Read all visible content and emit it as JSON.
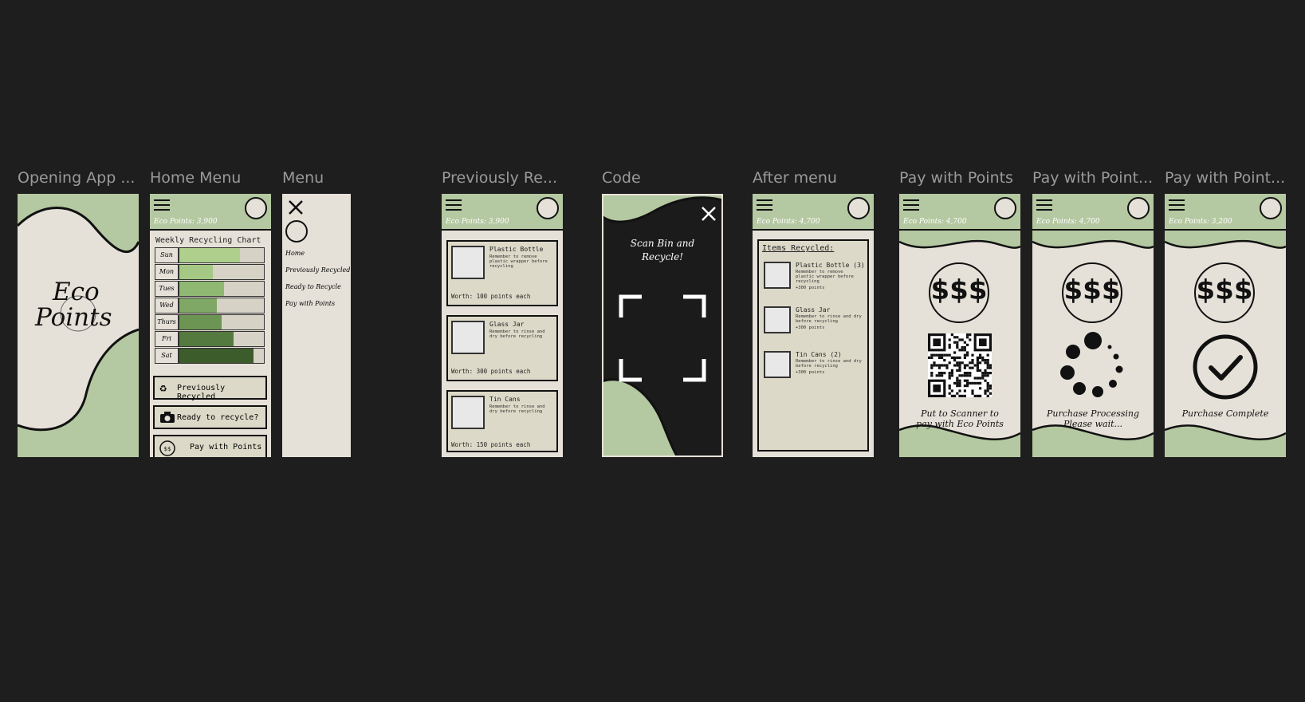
{
  "frames": {
    "opening": {
      "title": "Opening App ...",
      "logo_line1": "Eco",
      "logo_line2": "Points"
    },
    "home": {
      "title": "Home Menu",
      "points": "Eco Points: 3,900",
      "chart_title": "Weekly Recycling Chart",
      "buttons": {
        "previously": "Previously Recycled",
        "ready": "Ready to recycle?",
        "pay": "Pay with Points"
      }
    },
    "menu": {
      "title": "Menu",
      "items": {
        "home": "Home",
        "previously": "Previously Recycled",
        "ready": "Ready to Recycle",
        "pay": "Pay with Points"
      }
    },
    "previously": {
      "title": "Previously Re...",
      "points": "Eco Points: 3,900",
      "items": [
        {
          "name": "Plastic Bottle",
          "note": "Remember to remove plastic wrapper before recycling",
          "worth": "Worth: 100 points each"
        },
        {
          "name": "Glass Jar",
          "note": "Remember to rinse and dry before recycling",
          "worth": "Worth: 300 points each"
        },
        {
          "name": "Tin Cans",
          "note": "Remember to rinse and dry before recycling",
          "worth": "Worth: 150 points each"
        }
      ]
    },
    "code": {
      "title": "Code",
      "instruction_line1": "Scan Bin and",
      "instruction_line2": "Recycle!"
    },
    "after": {
      "title": "After menu",
      "points": "Eco Points: 4,700",
      "heading": "Items Recycled:",
      "items": [
        {
          "name": "Plastic Bottle (3)",
          "note": "Remember to remove plastic wrapper before recycling",
          "points": "+300 points"
        },
        {
          "name": "Glass Jar",
          "note": "Remember to rinse and dry before recycling",
          "points": "+300 points"
        },
        {
          "name": "Tin Cans (2)",
          "note": "Remember to rinse and dry before recycling",
          "points": "+300 points"
        }
      ]
    },
    "pay1": {
      "title": "Pay with Points",
      "points": "Eco Points: 4,700",
      "badge": "$$$",
      "caption_line1": "Put to Scanner to",
      "caption_line2": "pay with Eco Points"
    },
    "pay2": {
      "title": "Pay with Point...",
      "points": "Eco Points: 4,700",
      "badge": "$$$",
      "caption_line1": "Purchase Processing",
      "caption_line2": "Please wait..."
    },
    "pay3": {
      "title": "Pay with Point...",
      "points": "Eco Points: 3,200",
      "badge": "$$$",
      "caption_line1": "Purchase Complete"
    }
  },
  "chart_data": {
    "type": "bar",
    "title": "Weekly Recycling Chart",
    "categories": [
      "Sun",
      "Mon",
      "Tues",
      "Wed",
      "Thurs",
      "Fri",
      "Sat"
    ],
    "values": [
      72,
      40,
      53,
      44,
      50,
      64,
      88
    ],
    "xlim": [
      0,
      100
    ]
  },
  "colors": {
    "background": "#1e1e1e",
    "cream": "#e6e1d8",
    "sage": "#b4c8a1",
    "ink": "#111111",
    "dark_frame": "#1b1b1b"
  }
}
